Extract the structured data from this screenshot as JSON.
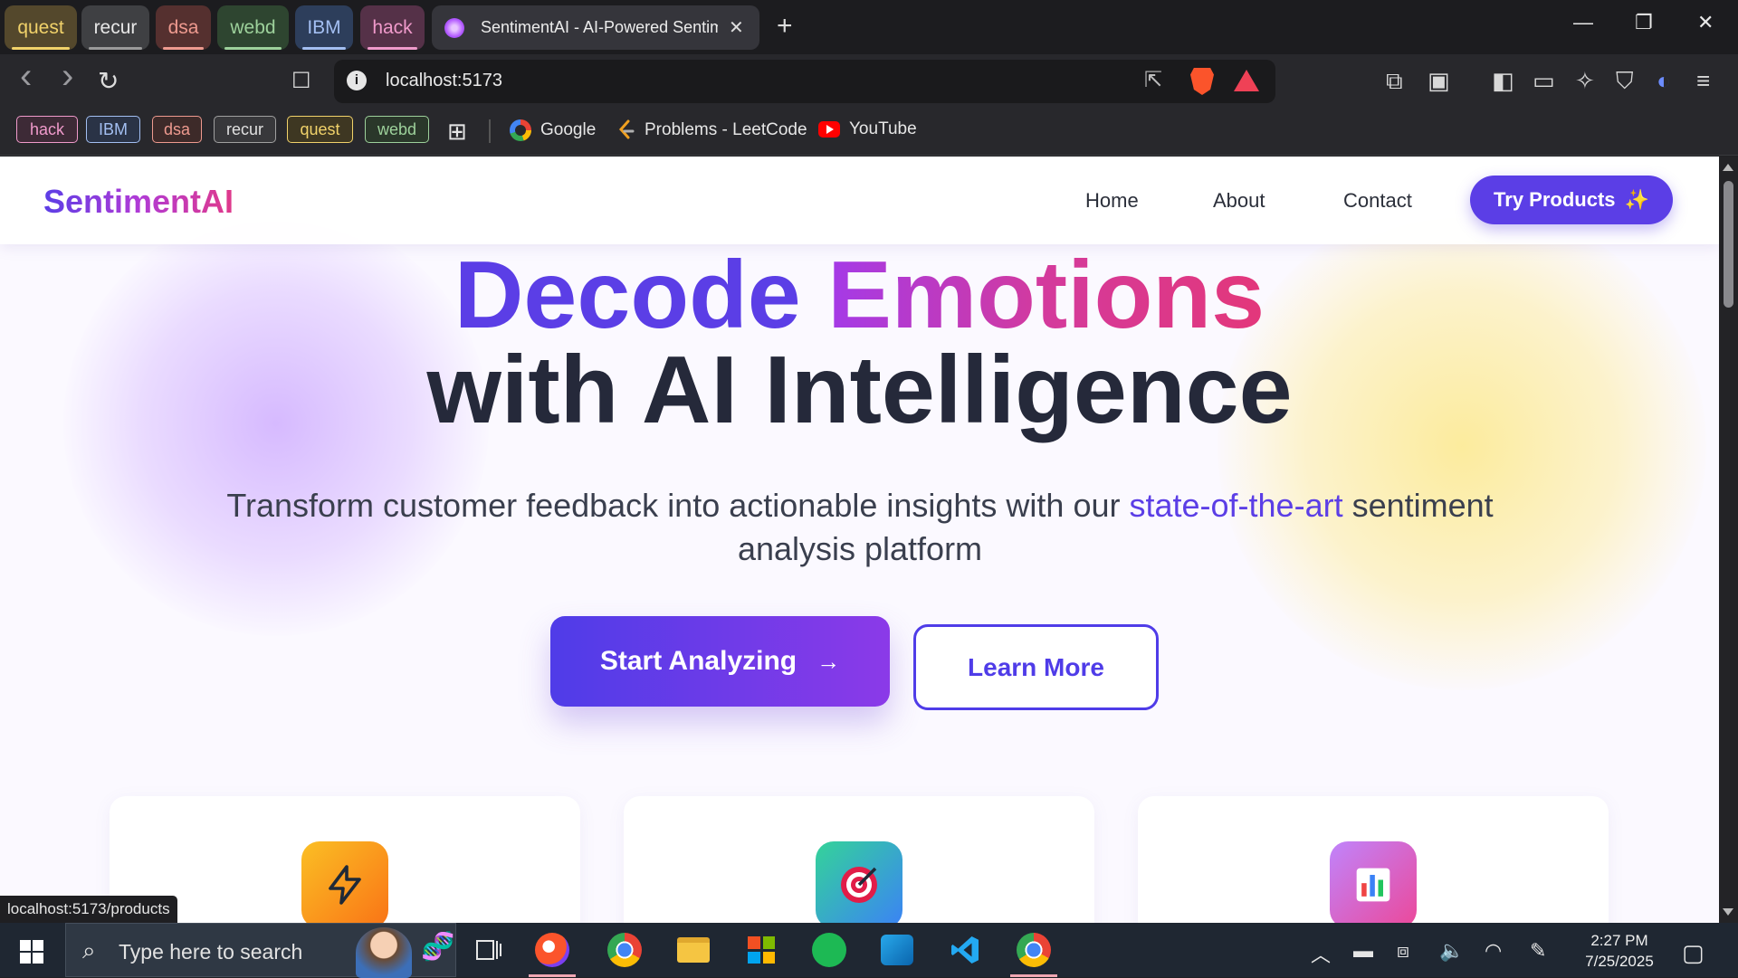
{
  "browser": {
    "tab_groups": [
      {
        "label": "quest",
        "color": "#f1d26a"
      },
      {
        "label": "recur",
        "color": "#c7c7c7"
      },
      {
        "label": "dsa",
        "color": "#ee9a8f"
      },
      {
        "label": "webd",
        "color": "#9dd19b"
      },
      {
        "label": "IBM",
        "color": "#a3bff2"
      },
      {
        "label": "hack",
        "color": "#f09acb"
      }
    ],
    "active_tab": {
      "title": "SentimentAI - AI-Powered Sentiment Analysis",
      "close": "✕"
    },
    "new_tab": "+",
    "window_controls": {
      "minimize": "—",
      "restore": "❐",
      "close": "✕"
    },
    "nav": {
      "back": "‹",
      "forward": "›",
      "reload": "↻",
      "bookmark": "☐"
    },
    "address_bar": {
      "info": "i",
      "url": "localhost:5173",
      "share": "⇱"
    },
    "bookmarks_bar": {
      "groups": [
        {
          "label": "hack",
          "color": "#f09acb"
        },
        {
          "label": "IBM",
          "color": "#a3bff2"
        },
        {
          "label": "dsa",
          "color": "#ee9a8f"
        },
        {
          "label": "recur",
          "color": "#c7c7c7"
        },
        {
          "label": "quest",
          "color": "#f1d26a"
        },
        {
          "label": "webd",
          "color": "#9dd19b"
        }
      ],
      "apps_icon": "apps-grid-icon",
      "links": [
        {
          "label": "Google",
          "icon": "google-icon"
        },
        {
          "label": "Problems - LeetCode",
          "icon": "leetcode-icon"
        },
        {
          "label": "YouTube",
          "icon": "youtube-icon"
        }
      ]
    },
    "status_url": "localhost:5173/products"
  },
  "site": {
    "logo": "SentimentAI",
    "nav_links": [
      "Home",
      "About",
      "Contact"
    ],
    "cta_nav": {
      "label": "Try Products",
      "icon": "✨"
    },
    "hero": {
      "line1_word1": "Decode",
      "line1_word2": "Emotions",
      "line2": "with AI Intelligence",
      "sub_before": "Transform customer feedback into actionable insights with our ",
      "sub_highlight": "state-of-the-art",
      "sub_after": " sentiment analysis platform"
    },
    "buttons": {
      "primary": "Start Analyzing",
      "primary_arrow": "→",
      "secondary": "Learn More"
    },
    "features": [
      {
        "icon": "lightning-icon",
        "glyph": "⚡"
      },
      {
        "icon": "target-icon",
        "glyph": "🎯"
      },
      {
        "icon": "chart-icon",
        "glyph": "📊"
      }
    ],
    "colors": {
      "brand": "#5b3ee6",
      "accent_pink": "#e0398a",
      "heading_dark": "#25293a"
    }
  },
  "taskbar": {
    "search_placeholder": "Type here to search",
    "clock": {
      "time": "2:27 PM",
      "date": "7/25/2025"
    }
  }
}
